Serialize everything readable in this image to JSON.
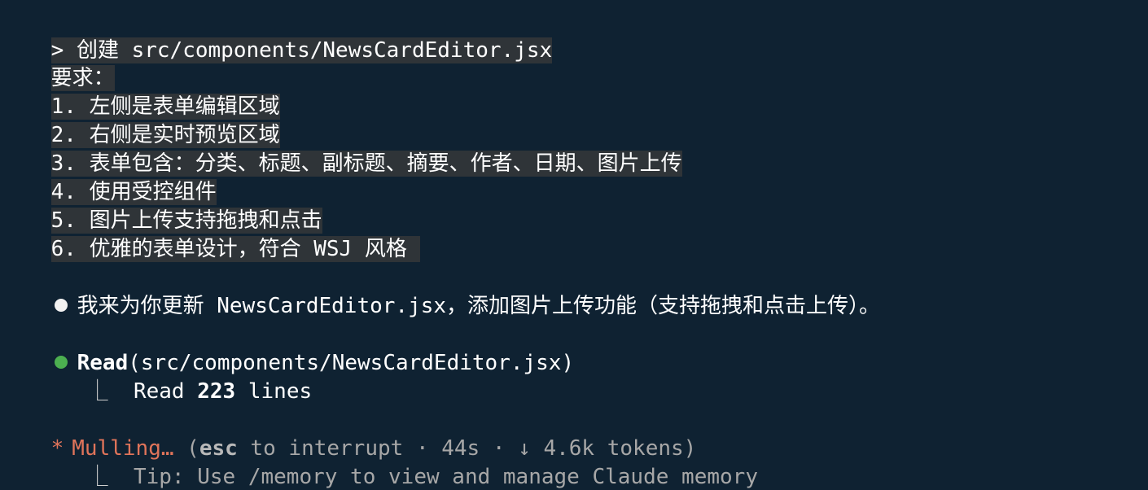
{
  "prompt": {
    "marker": ">",
    "title": "创建 src/components/NewsCardEditor.jsx",
    "requirements_label": "要求：",
    "items": [
      "1. 左侧是表单编辑区域",
      "2. 右侧是实时预览区域",
      "3. 表单包含：分类、标题、副标题、摘要、作者、日期、图片上传",
      "4. 使用受控组件",
      "5. 图片上传支持拖拽和点击",
      "6. 优雅的表单设计，符合 WSJ 风格 "
    ]
  },
  "assistant": {
    "message": "我来为你更新 NewsCardEditor.jsx，添加图片上传功能（支持拖拽和点击上传）。"
  },
  "tool": {
    "name": "Read",
    "args": "(src/components/NewsCardEditor.jsx)",
    "result_prefix": "Read ",
    "result_count": "223",
    "result_suffix": " lines",
    "elbow": "⎿"
  },
  "status": {
    "star": "*",
    "verb": "Mulling…",
    "open_paren": " (",
    "esc_key": "esc",
    "rest": " to interrupt · 44s · ↓ 4.6k tokens)",
    "tip_elbow": "⎿",
    "tip": "Tip: Use /memory to view and manage Claude memory"
  },
  "colors": {
    "background": "#0f2232",
    "highlight": "#2f3438",
    "accent": "#e0745a",
    "success": "#4caf50"
  }
}
